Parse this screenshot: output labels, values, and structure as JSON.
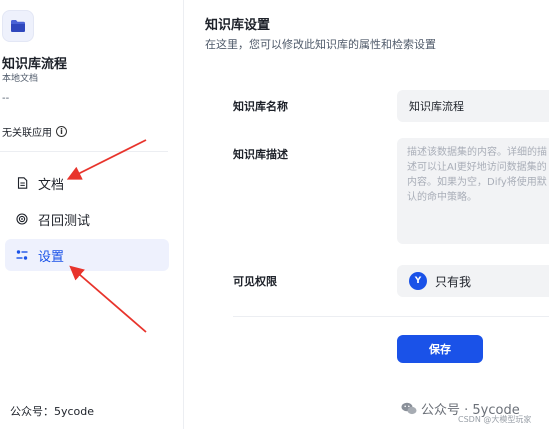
{
  "sidebar": {
    "kb_name": "知识库流程",
    "kb_type": "本地文档",
    "kb_dash": "--",
    "associated_apps": "无关联应用",
    "info_icon": "info-circle-icon",
    "nav_items": [
      {
        "label": "文档",
        "icon": "document-icon",
        "active": false
      },
      {
        "label": "召回测试",
        "icon": "target-icon",
        "active": false
      },
      {
        "label": "设置",
        "icon": "settings-sliders-icon",
        "active": true
      }
    ],
    "footer_text": "公众号：5ycode"
  },
  "main": {
    "title": "知识库设置",
    "subtitle": "在这里，您可以修改此知识库的属性和检索设置",
    "form": {
      "name_label": "知识库名称",
      "name_value": "知识库流程",
      "desc_label": "知识库描述",
      "desc_placeholder": "描述该数据集的内容。详细的描述可以让AI更好地访问数据集的内容。如果为空，Dify将使用默认的命中策略。",
      "permission_label": "可见权限",
      "permission_avatar": "Y",
      "permission_value": "只有我"
    },
    "save_label": "保存"
  },
  "watermark": {
    "text": "公众号 · 5ycode",
    "csdn": "CSDN @大模型玩家"
  },
  "colors": {
    "accent": "#1a52e8",
    "active_bg": "#eef1fd",
    "input_bg": "#f2f3f5",
    "annotation_arrow": "#e8342c"
  }
}
